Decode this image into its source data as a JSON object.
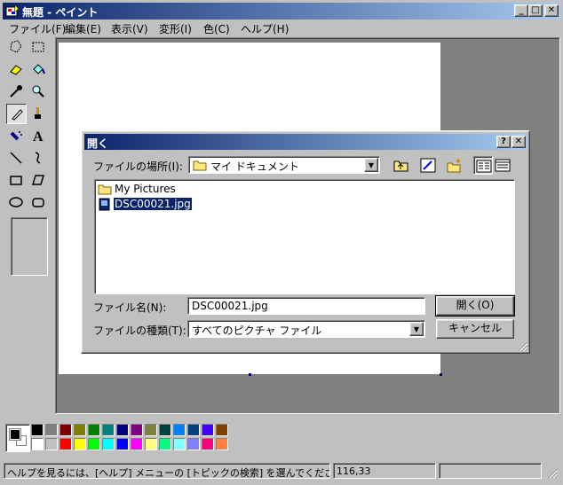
{
  "window": {
    "title": "無題 - ペイント",
    "controls": {
      "minimize": "_",
      "maximize": "□",
      "close": "✕"
    }
  },
  "menu": [
    "ファイル(F)",
    "編集(E)",
    "表示(V)",
    "変形(I)",
    "色(C)",
    "ヘルプ(H)"
  ],
  "toolbox": {
    "tools": [
      "free-select-icon",
      "rect-select-icon",
      "eraser-icon",
      "fill-icon",
      "color-picker-icon",
      "magnifier-icon",
      "pencil-icon",
      "brush-icon",
      "airbrush-icon",
      "text-icon",
      "line-icon",
      "curve-icon",
      "rectangle-icon",
      "polygon-icon",
      "ellipse-icon",
      "rounded-rect-icon"
    ],
    "active_tool": "pencil-icon",
    "text_tool_glyph": "A"
  },
  "palette": {
    "foreground": "#000000",
    "background": "#ffffff",
    "row1": [
      "#000000",
      "#808080",
      "#800000",
      "#808000",
      "#008000",
      "#008080",
      "#000080",
      "#800080",
      "#808040",
      "#004040",
      "#0080ff",
      "#004080",
      "#4000ff",
      "#804000"
    ],
    "row2": [
      "#ffffff",
      "#c0c0c0",
      "#ff0000",
      "#ffff00",
      "#00ff00",
      "#00ffff",
      "#0000ff",
      "#ff00ff",
      "#ffff80",
      "#00ff80",
      "#80ffff",
      "#8080ff",
      "#ff0080",
      "#ff8040"
    ]
  },
  "statusbar": {
    "help": "ヘルプを見るには、[ヘルプ] メニューの [トピックの検索] を選んでください。",
    "coords": "116,33",
    "size": ""
  },
  "dialog": {
    "title": "開く",
    "help_button": "?",
    "close_button": "✕",
    "look_in_label": "ファイルの場所(I):",
    "look_in_value": "マイ ドキュメント",
    "files": [
      {
        "name": "My Pictures",
        "icon": "folder-icon",
        "selected": false
      },
      {
        "name": "DSC00021.jpg",
        "icon": "image-file-icon",
        "selected": true
      }
    ],
    "filename_label": "ファイル名(N):",
    "filename_value": "DSC00021.jpg",
    "filetype_label": "ファイルの種類(T):",
    "filetype_value": "すべてのピクチャ ファイル",
    "open_button": "開く(O)",
    "cancel_button": "キャンセル"
  }
}
